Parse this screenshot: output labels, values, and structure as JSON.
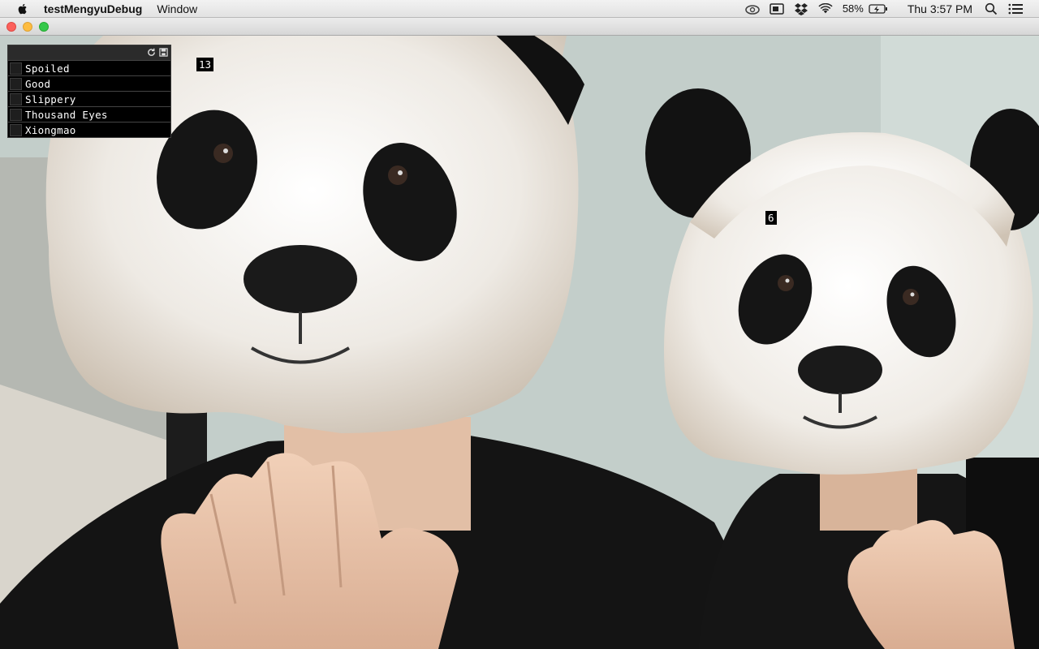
{
  "menubar": {
    "app_name": "testMengyuDebug",
    "menus": [
      "Window"
    ],
    "battery_percent": "58%",
    "clock": "Thu 3:57 PM",
    "icons": [
      "apple-icon",
      "creative-cloud-icon",
      "display-icon",
      "dropbox-icon",
      "wifi-icon",
      "battery-icon",
      "spotlight-search-icon",
      "notification-center-icon"
    ]
  },
  "window": {
    "traffic_lights": [
      "close",
      "minimize",
      "maximize"
    ]
  },
  "gui": {
    "header_icons": [
      "refresh-icon",
      "save-icon"
    ],
    "items": [
      {
        "label": "Spoiled",
        "checked": false
      },
      {
        "label": "Good",
        "checked": false
      },
      {
        "label": "Slippery",
        "checked": false
      },
      {
        "label": "Thousand Eyes",
        "checked": false
      },
      {
        "label": "Xiongmao",
        "checked": false
      }
    ]
  },
  "overlays": {
    "face_left_id": "13",
    "face_right_id": "6"
  },
  "colors": {
    "close": "#fc605b",
    "minimize": "#fdbc40",
    "maximize": "#34c84a",
    "gui_background": "#000000",
    "gui_text": "#ffffff"
  }
}
